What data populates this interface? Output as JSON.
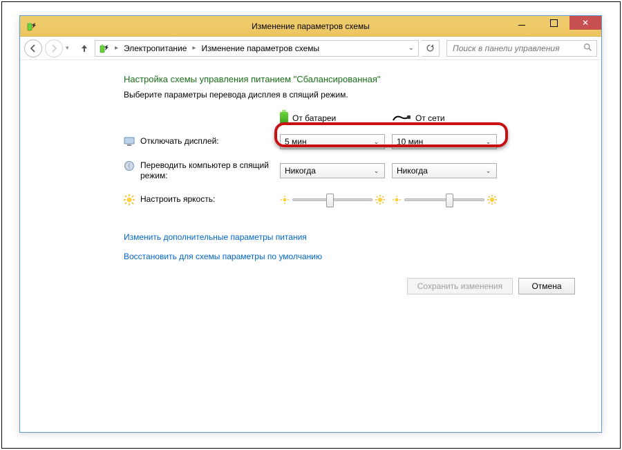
{
  "titlebar": {
    "title": "Изменение параметров схемы"
  },
  "breadcrumb": {
    "item1": "Электропитание",
    "item2": "Изменение параметров схемы"
  },
  "search": {
    "placeholder": "Поиск в панели управления"
  },
  "heading": "Настройка схемы управления питанием \"Сбалансированная\"",
  "subheading": "Выберите параметры перевода дисплея в спящий режим.",
  "columns": {
    "battery": "От батареи",
    "ac": "От сети"
  },
  "rows": {
    "display": {
      "label": "Отключать дисплей:",
      "battery": "5 мин",
      "ac": "10 мин"
    },
    "sleep": {
      "label": "Переводить компьютер в спящий режим:",
      "battery": "Никогда",
      "ac": "Никогда"
    },
    "brightness": {
      "label": "Настроить яркость:"
    }
  },
  "links": {
    "advanced": "Изменить дополнительные параметры питания",
    "restore": "Восстановить для схемы параметры по умолчанию"
  },
  "buttons": {
    "save": "Сохранить изменения",
    "cancel": "Отмена"
  }
}
